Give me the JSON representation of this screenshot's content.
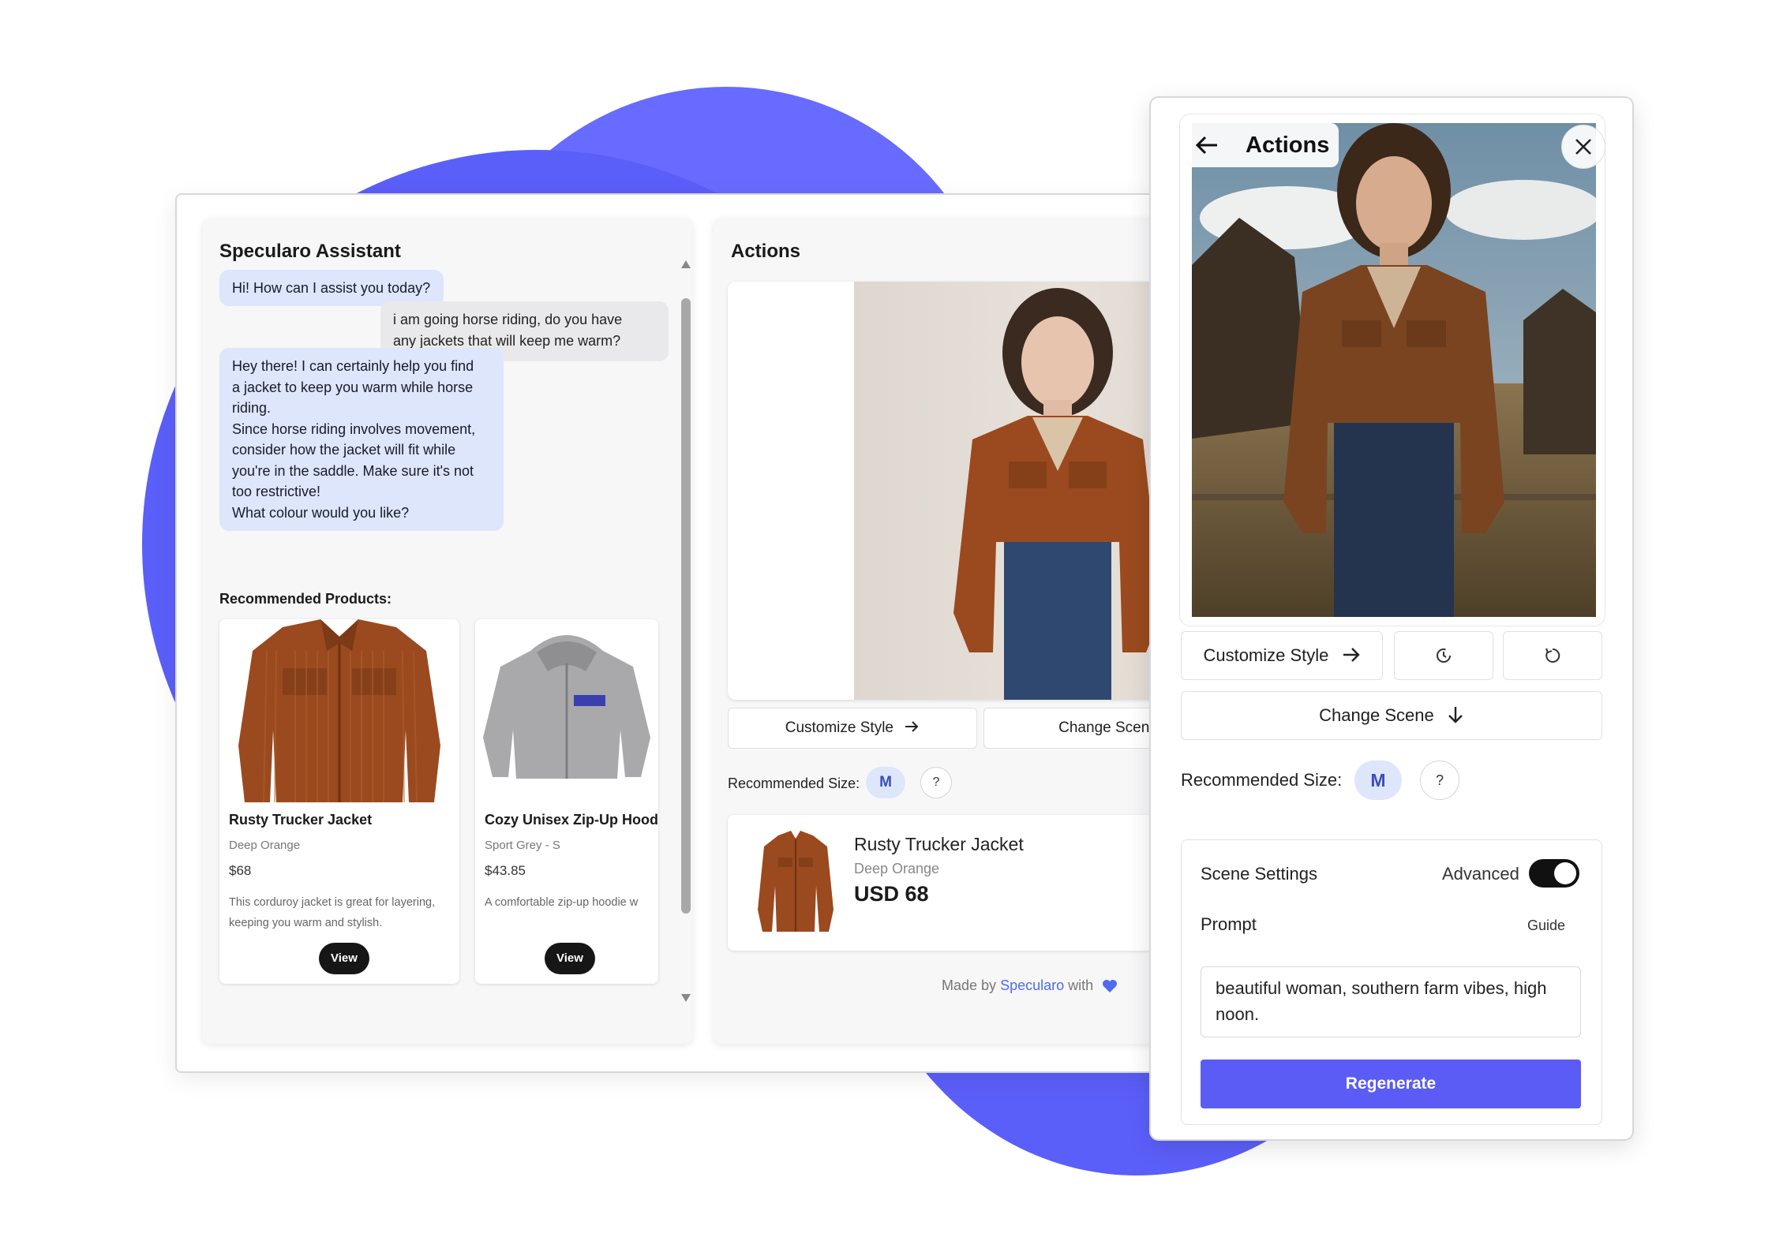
{
  "chat": {
    "title": "Specularo Assistant",
    "messages": [
      {
        "role": "bot",
        "lines": [
          "Hi! How can I assist you today?"
        ]
      },
      {
        "role": "user",
        "lines": [
          "i am going horse riding, do you have",
          "any jackets that will keep me warm?"
        ]
      },
      {
        "role": "bot",
        "lines": [
          "Hey there! I can certainly help you find",
          "a jacket to keep you warm while horse",
          "riding.",
          "Since horse riding involves movement,",
          "consider how the jacket will fit while",
          "you're in the saddle. Make sure it's not",
          "too restrictive!",
          "What colour would you like?"
        ]
      }
    ],
    "recommended_title": "Recommended Products:",
    "products": [
      {
        "name": "Rusty Trucker Jacket",
        "variant": "Deep Orange",
        "price": "$68",
        "description": "This corduroy jacket is great for layering, keeping you warm and stylish.",
        "button": "View"
      },
      {
        "name": "Cozy Unisex Zip-Up Hood",
        "variant": "Sport Grey - S",
        "price": "$43.85",
        "description": "A comfortable zip-up hoodie w",
        "button": "View"
      }
    ]
  },
  "actions": {
    "title": "Actions",
    "customize_label": "Customize Style",
    "change_scene_label": "Change Scene",
    "size_label": "Recommended Size:",
    "size_value": "M",
    "help_label": "?",
    "selected": {
      "name": "Rusty Trucker Jacket",
      "variant": "Deep Orange",
      "price": "USD 68"
    },
    "made_by_prefix": "Made by",
    "made_by_brand": "Specularo",
    "made_by_suffix": "with"
  },
  "overlay": {
    "title": "Actions",
    "customize_label": "Customize Style",
    "change_scene_label": "Change Scene",
    "size_label": "Recommended Size:",
    "size_value": "M",
    "help_label": "?",
    "scene_settings_label": "Scene Settings",
    "advanced_label": "Advanced",
    "advanced_on": true,
    "prompt_label": "Prompt",
    "guide_label": "Guide",
    "prompt_value": "beautiful woman, southern farm vibes, high noon.",
    "regenerate_label": "Regenerate"
  },
  "icons": {
    "back": "arrow-left-icon",
    "close": "close-icon",
    "arrow_right": "arrow-right-icon",
    "arrow_down": "arrow-down-icon",
    "history": "history-icon",
    "refresh": "refresh-icon",
    "heart": "heart-icon"
  },
  "colors": {
    "accent": "#5b5cf6",
    "blob": "#5b5ff9",
    "bot_bubble": "#dde6fb",
    "brand_link": "#4f6bf0"
  }
}
